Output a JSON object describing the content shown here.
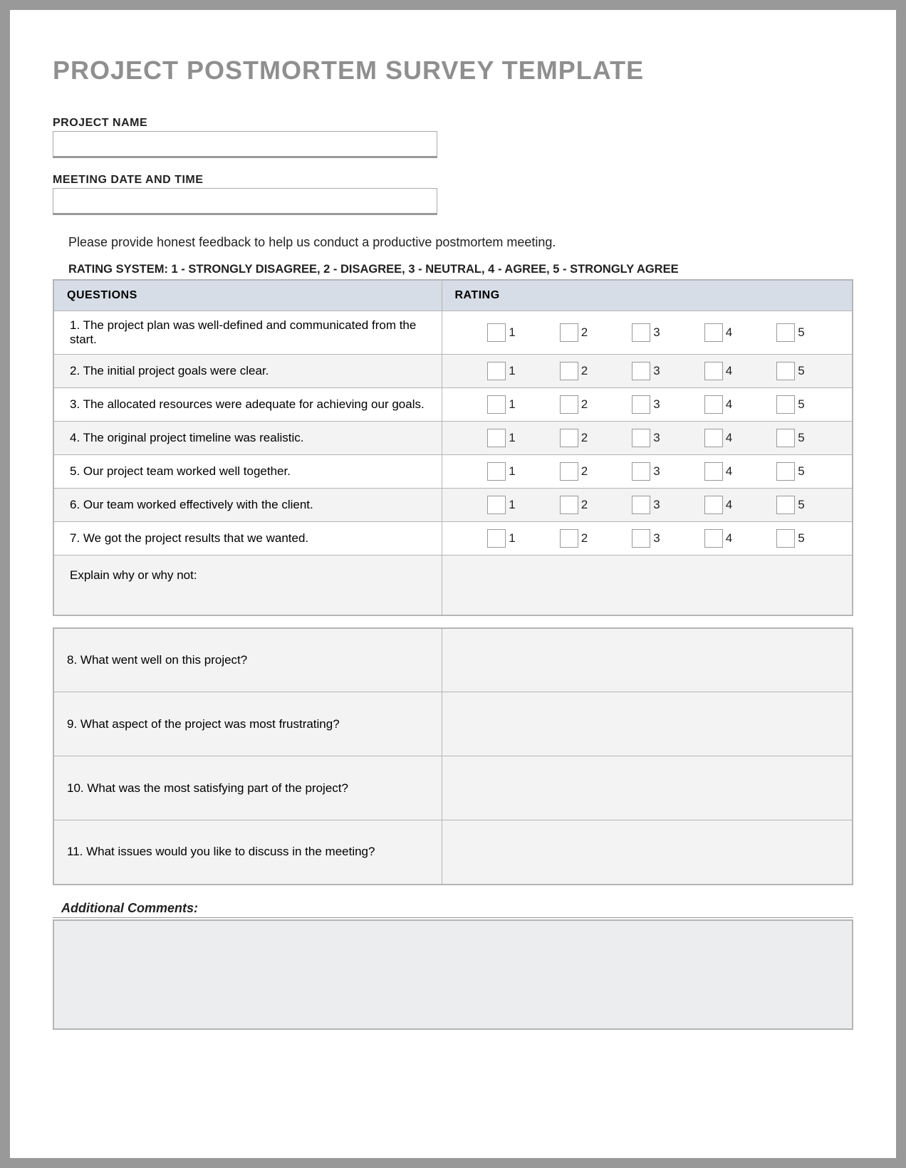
{
  "title": "PROJECT POSTMORTEM SURVEY TEMPLATE",
  "fields": {
    "project_name": {
      "label": "PROJECT NAME",
      "value": ""
    },
    "meeting_dt": {
      "label": "MEETING DATE AND TIME",
      "value": ""
    }
  },
  "intro": "Please provide honest feedback to help us conduct a productive postmortem meeting.",
  "rating_system": "RATING SYSTEM: 1 - STRONGLY DISAGREE, 2 - DISAGREE, 3 - NEUTRAL, 4 - AGREE, 5 - STRONGLY AGREE",
  "headers": {
    "questions": "QUESTIONS",
    "rating": "RATING"
  },
  "rating_labels": [
    "1",
    "2",
    "3",
    "4",
    "5"
  ],
  "questions": [
    "1. The project plan was well-defined and communicated from the start.",
    "2. The initial project goals were clear.",
    "3. The allocated resources were adequate for achieving our goals.",
    "4. The original project timeline was realistic.",
    "5. Our project team worked well together.",
    "6. Our team worked effectively with the client.",
    "7. We got the project results that we wanted."
  ],
  "explain": "Explain why or why not:",
  "open_questions": [
    "8. What went well on this project?",
    "9. What aspect of the project was most frustrating?",
    "10. What was the most satisfying part of the project?",
    "11. What issues would you like to discuss in the meeting?"
  ],
  "additional": {
    "label": "Additional Comments:",
    "value": ""
  }
}
